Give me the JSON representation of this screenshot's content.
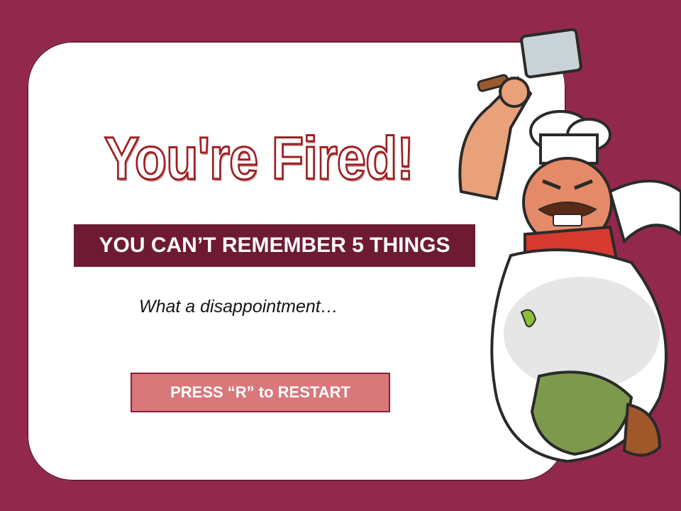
{
  "screen": {
    "title": "You're Fired!",
    "subtitle": "YOU CAN’T REMEMBER 5 THINGS",
    "tagline": "What a disappointment…",
    "restart_button": "PRESS “R” to RESTART"
  },
  "colors": {
    "background": "#92294c",
    "card": "#ffffff",
    "title_outline": "#9e1f22",
    "subtitle_bar": "#6e1a33",
    "button_fill": "#d9787b",
    "button_border": "#8b1d3f"
  },
  "illustration": {
    "icon": "angry-chef-with-cleaver-icon"
  }
}
